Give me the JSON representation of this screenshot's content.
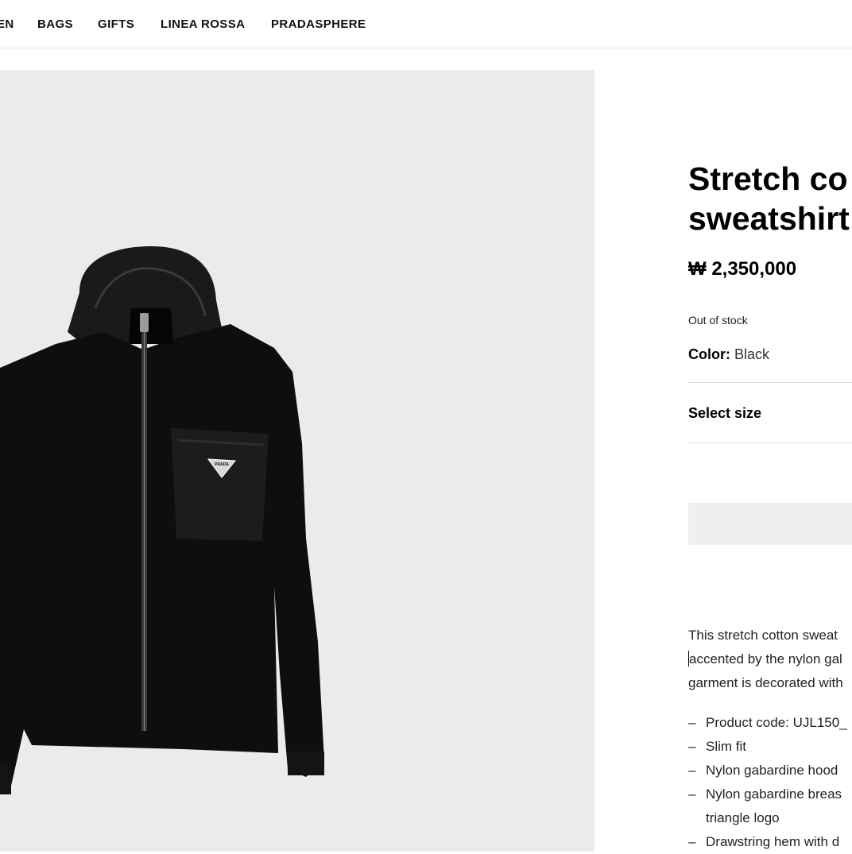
{
  "nav": {
    "items": [
      "EN",
      "BAGS",
      "GIFTS",
      "LINEA ROSSA",
      "PRADASPHERE"
    ]
  },
  "product": {
    "title_line1": "Stretch co",
    "title_line2": "sweatshirt",
    "price": "₩ 2,350,000",
    "stock_status": "Out of stock",
    "color_label": "Color:",
    "color_value": "Black",
    "size_label": "Select size",
    "logo_text": "PRADA",
    "description": [
      "This stretch cotton sweat",
      "accented by the nylon gal",
      "garment is decorated with"
    ],
    "bullets": [
      "Product code: UJL150_",
      "Slim fit",
      "Nylon gabardine hood",
      "Nylon gabardine breas",
      "triangle logo",
      "Drawstring hem with d"
    ],
    "bullet_dashes": [
      "–",
      "–",
      "–",
      "–",
      "",
      "–"
    ]
  },
  "colors": {
    "image_bg": "#ebebed",
    "jacket": "#0d0d0d",
    "nylon": "#1b1b1b",
    "button_bg": "#efefef"
  },
  "icons": {
    "logo": "prada-triangle-logo-icon"
  }
}
